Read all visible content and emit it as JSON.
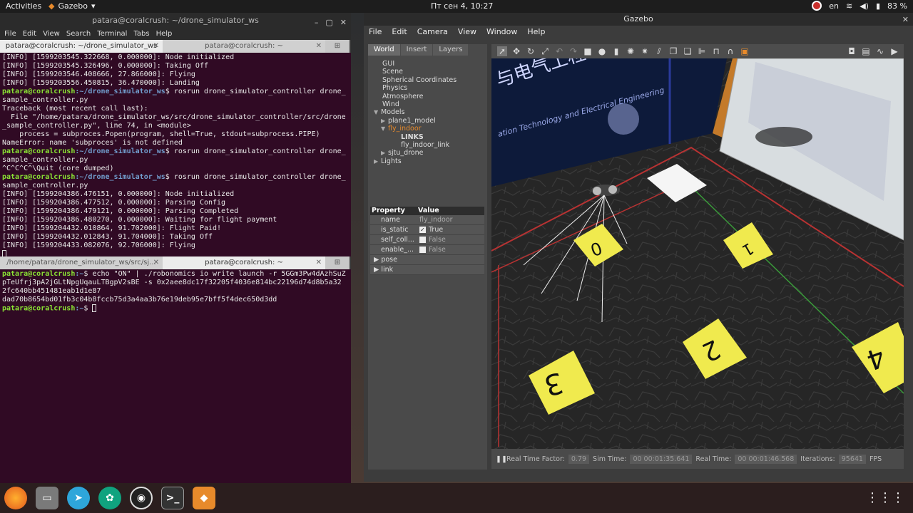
{
  "topbar": {
    "activities": "Activities",
    "app": "Gazebo",
    "clock": "Пт сен  4, 10:27",
    "lang": "en",
    "battery": "83 %"
  },
  "terminal": {
    "title": "patara@coralcrush: ~/drone_simulator_ws",
    "menu": [
      "File",
      "Edit",
      "View",
      "Search",
      "Terminal",
      "Tabs",
      "Help"
    ],
    "tabs_top": [
      "patara@coralcrush: ~/drone_simulator_ws",
      "patara@coralcrush: ~"
    ],
    "tabs_bottom": [
      "/home/patara/drone_simulator_ws/src/sj...",
      "patara@coralcrush: ~"
    ],
    "lines_top": [
      {
        "t": "[INFO] [1599203545.322668, 0.000000]: Node initialized"
      },
      {
        "t": "[INFO] [1599203545.326496, 0.000000]: Taking Off"
      },
      {
        "t": "[INFO] [1599203546.408666, 27.866000]: Flying"
      },
      {
        "t": "[INFO] [1599203556.450815, 36.470000]: Landing"
      },
      {
        "u": "patara@coralcrush",
        "p": ":~/drone_simulator_ws",
        "t": "$ rosrun drone_simulator_controller drone_"
      },
      {
        "t": "sample_controller.py"
      },
      {
        "t": "Traceback (most recent call last):"
      },
      {
        "t": "  File \"/home/patara/drone_simulator_ws/src/drone_simulator_controller/src/drone"
      },
      {
        "t": "_sample_controller.py\", line 74, in <module>"
      },
      {
        "t": "    process = subproces.Popen(program, shell=True, stdout=subprocess.PIPE)"
      },
      {
        "t": "NameError: name 'subproces' is not defined"
      },
      {
        "u": "patara@coralcrush",
        "p": ":~/drone_simulator_ws",
        "t": "$ rosrun drone_simulator_controller drone_"
      },
      {
        "t": "sample_controller.py"
      },
      {
        "t": "^C^C^C^\\Quit (core dumped)"
      },
      {
        "u": "patara@coralcrush",
        "p": ":~/drone_simulator_ws",
        "t": "$ rosrun drone_simulator_controller drone_"
      },
      {
        "t": "sample_controller.py"
      },
      {
        "t": "[INFO] [1599204386.476151, 0.000000]: Node initialized"
      },
      {
        "t": "[INFO] [1599204386.477512, 0.000000]: Parsing Config"
      },
      {
        "t": "[INFO] [1599204386.479121, 0.000000]: Parsing Completed"
      },
      {
        "t": "[INFO] [1599204386.480270, 0.000000]: Waiting for flight payment"
      },
      {
        "t": "[INFO] [1599204432.010864, 91.702000]: Flight Paid!"
      },
      {
        "t": "[INFO] [1599204432.012843, 91.704000]: Taking Off"
      },
      {
        "t": "[INFO] [1599204433.082076, 92.706000]: Flying"
      }
    ],
    "lines_bottom": [
      {
        "u": "patara@coralcrush",
        "p": ":~",
        "t": "$ echo \"ON\" | ./robonomics io write launch -r 5GGm3Pw4dAzhSuZ"
      },
      {
        "t": "pTeUfrj3pA2jGLtNpgUqauLTBgpV2sBE -s 0x2aee8dc17f32205f4036e814bc22196d74d8b5a32"
      },
      {
        "t": "2fc640bb451481eab1d1e87"
      },
      {
        "t": "dad70b8654bd01fb3c04b8fccb75d3a4aa3b76e19deb95e7bff5f4dec650d3dd"
      },
      {
        "u": "patara@coralcrush",
        "p": ":~",
        "t": "$ "
      }
    ]
  },
  "gazebo": {
    "title": "Gazebo",
    "menu": [
      "File",
      "Edit",
      "Camera",
      "View",
      "Window",
      "Help"
    ],
    "tabs": [
      "World",
      "Insert",
      "Layers"
    ],
    "tree": {
      "gui": "GUI",
      "scene": "Scene",
      "spherical": "Spherical Coordinates",
      "physics": "Physics",
      "atmosphere": "Atmosphere",
      "wind": "Wind",
      "models": "Models",
      "plane": "plane1_model",
      "fly": "fly_indoor",
      "links": "LINKS",
      "fly_link": "fly_indoor_link",
      "sjtu": "sjtu_drone",
      "lights": "Lights"
    },
    "props": {
      "h_prop": "Property",
      "h_val": "Value",
      "name_k": "name",
      "name_v": "fly_indoor",
      "static_k": "is_static",
      "static_v": "True",
      "self_k": "self_coll...",
      "self_v": "False",
      "enable_k": "enable_...",
      "enable_v": "False",
      "pose": "pose",
      "link": "link"
    },
    "status": {
      "rtf_label": "Real Time Factor:",
      "rtf": "0.79",
      "sim_label": "Sim Time:",
      "sim": "00 00:01:35.641",
      "real_label": "Real Time:",
      "real": "00 00:01:46.568",
      "iter_label": "Iterations:",
      "iter": "95641",
      "fps_label": "FPS"
    },
    "scene_text": {
      "banner_cn": "与电气工程研究院",
      "banner_en": "ation Technology and Electrical Engineering",
      "marker_0": "0",
      "marker_1": "1",
      "marker_2": "2",
      "marker_3": "3",
      "marker_4": "4"
    }
  },
  "dock": {
    "apps": [
      "firefox-icon",
      "files-icon",
      "telegram-icon",
      "chatgpt-icon",
      "obs-icon",
      "terminal-icon",
      "gazebo-icon"
    ]
  }
}
